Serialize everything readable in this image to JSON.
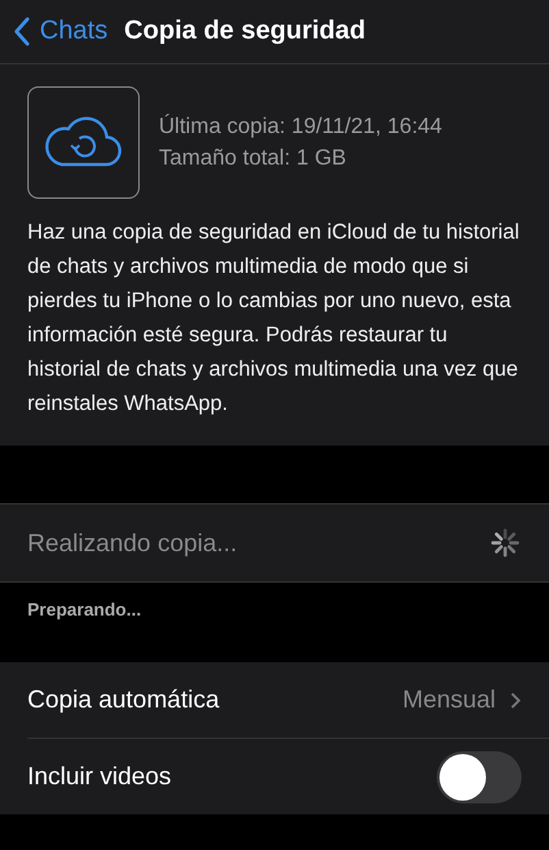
{
  "nav": {
    "back": "Chats",
    "title": "Copia de seguridad"
  },
  "backup": {
    "last": "Última copia: 19/11/21, 16:44",
    "size": "Tamaño total: 1 GB",
    "description": "Haz una copia de seguridad en iCloud de tu historial de chats y archivos multimedia de modo que si pierdes tu iPhone o lo cambias por uno nuevo, esta información esté segura. Podrás restaurar tu historial de chats y archivos multimedia una vez que reinstales WhatsApp."
  },
  "action": {
    "label": "Realizando copia...",
    "disabled": true,
    "busy": true
  },
  "status": "Preparando...",
  "settings": [
    {
      "kind": "value",
      "label": "Copia automática",
      "value": "Mensual"
    },
    {
      "kind": "toggle",
      "label": "Incluir videos",
      "on": false
    }
  ]
}
